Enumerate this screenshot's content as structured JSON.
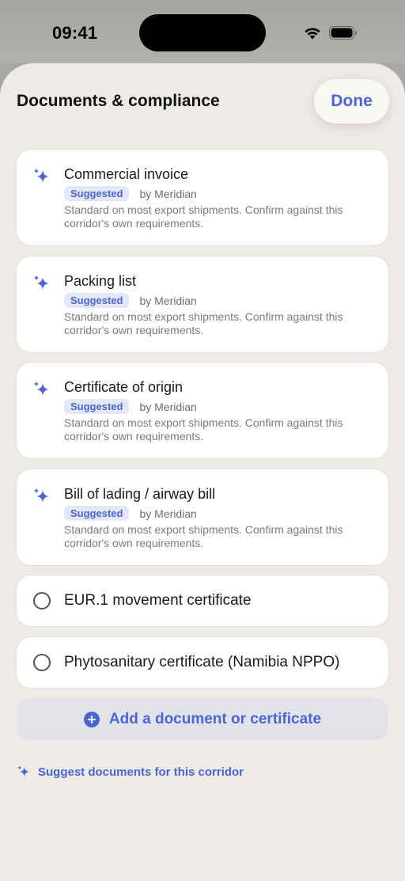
{
  "status_bar": {
    "time": "09:41"
  },
  "header": {
    "title": "Documents & compliance",
    "done_label": "Done"
  },
  "suggested_docs": [
    {
      "title": "Commercial invoice",
      "badge": "Suggested",
      "by": "by Meridian",
      "description": "Standard on most export shipments. Confirm against this corridor's own requirements."
    },
    {
      "title": "Packing list",
      "badge": "Suggested",
      "by": "by Meridian",
      "description": "Standard on most export shipments. Confirm against this corridor's own requirements."
    },
    {
      "title": "Certificate of origin",
      "badge": "Suggested",
      "by": "by Meridian",
      "description": "Standard on most export shipments. Confirm against this corridor's own requirements."
    },
    {
      "title": "Bill of lading / airway bill",
      "badge": "Suggested",
      "by": "by Meridian",
      "description": "Standard on most export shipments. Confirm against this corridor's own requirements."
    }
  ],
  "other_docs": [
    {
      "title": "EUR.1 movement certificate",
      "checked": false
    },
    {
      "title": "Phytosanitary certificate (Namibia NPPO)",
      "checked": false
    }
  ],
  "actions": {
    "add_label": "Add a document or certificate",
    "suggest_label": "Suggest documents for this corridor"
  },
  "colors": {
    "accent": "#4b66d1",
    "sheet_bg": "#eeebe6",
    "badge_bg": "#e3e7f6"
  }
}
